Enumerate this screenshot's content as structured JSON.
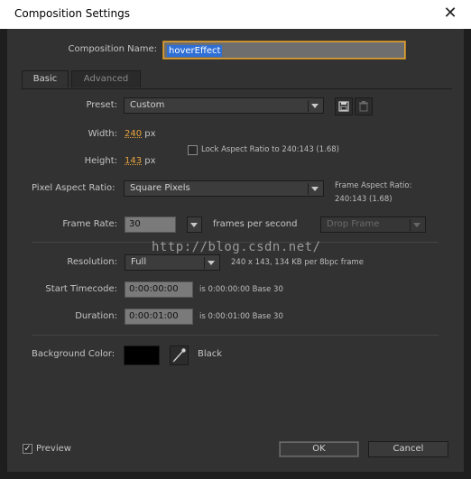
{
  "window": {
    "title": "Composition Settings",
    "close_icon": "close-icon"
  },
  "composition_name": {
    "label": "Composition Name:",
    "value": "hoverEffect"
  },
  "tabs": [
    {
      "label": "Basic"
    },
    {
      "label": "Advanced"
    }
  ],
  "preset": {
    "label": "Preset:",
    "value": "Custom"
  },
  "width": {
    "label": "Width:",
    "value": "240",
    "unit": "px"
  },
  "height": {
    "label": "Height:",
    "value": "143",
    "unit": "px"
  },
  "lock_aspect": {
    "label": "Lock Aspect Ratio to 240:143 (1.68)",
    "checked": false
  },
  "pixel_aspect": {
    "label": "Pixel Aspect Ratio:",
    "value": "Square Pixels"
  },
  "frame_aspect": {
    "label": "Frame Aspect Ratio:",
    "value": "240:143 (1.68)"
  },
  "frame_rate": {
    "label": "Frame Rate:",
    "value": "30",
    "suffix": "frames per second",
    "drop_frame": "Drop Frame"
  },
  "watermark": "http://blog.csdn.net/",
  "resolution": {
    "label": "Resolution:",
    "value": "Full",
    "info": "240 x 143, 134 KB per 8bpc frame"
  },
  "start_timecode": {
    "label": "Start Timecode:",
    "value": "0:00:00:00",
    "info": "is 0:00:00:00  Base 30"
  },
  "duration": {
    "label": "Duration:",
    "value": "0:00:01:00",
    "info": "is 0:00:01:00  Base 30"
  },
  "background_color": {
    "label": "Background Color:",
    "name": "Black",
    "color": "#000000"
  },
  "preview": {
    "label": "Preview",
    "checked": true
  },
  "buttons": {
    "ok": "OK",
    "cancel": "Cancel"
  }
}
